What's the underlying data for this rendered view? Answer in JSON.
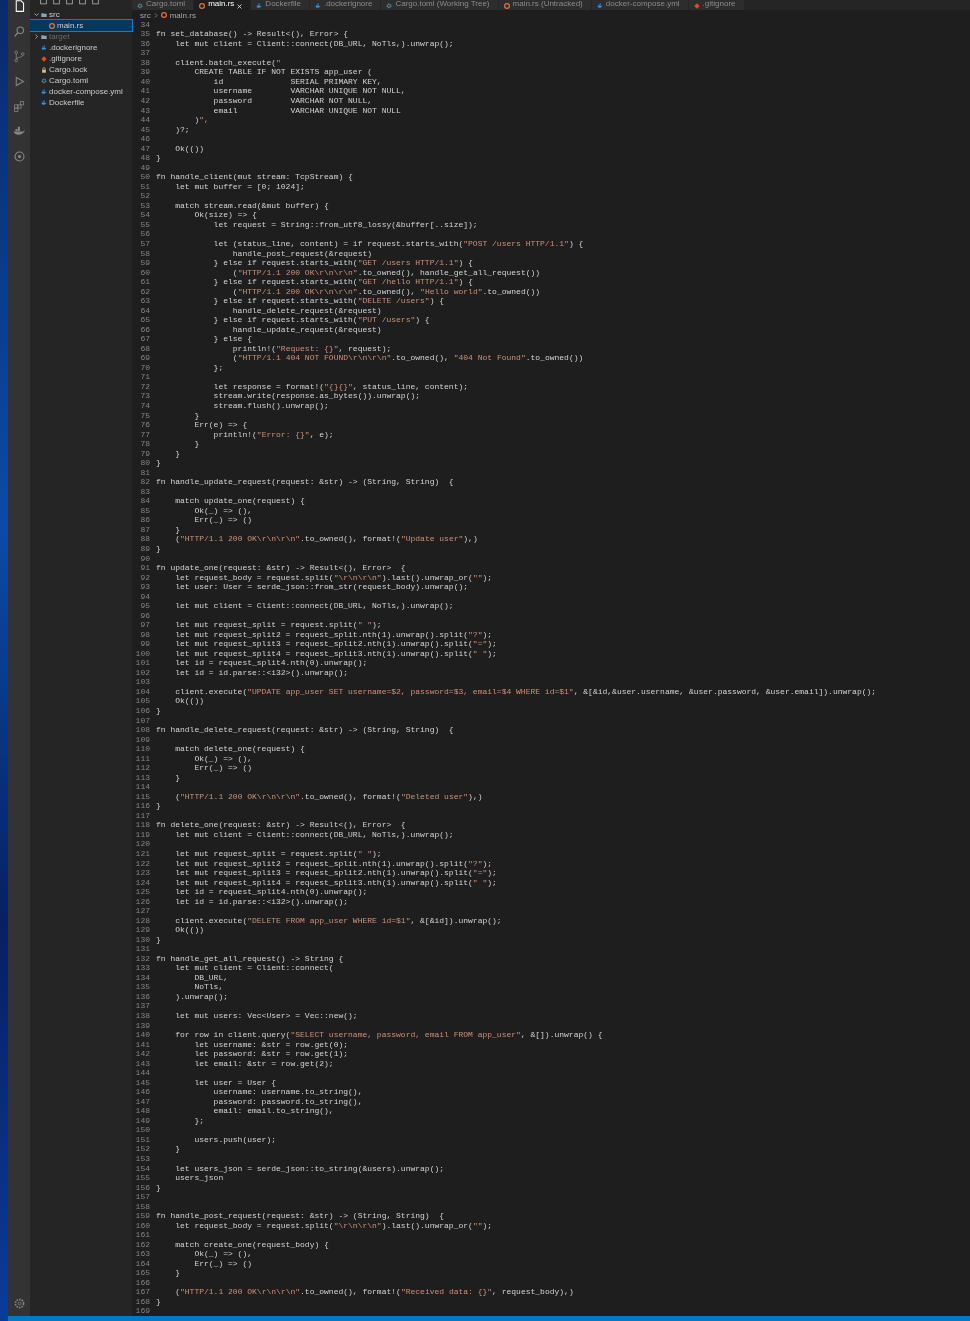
{
  "tabs": [
    {
      "label": "Cargo.toml",
      "kind": "gear",
      "selected": false
    },
    {
      "label": "main.rs",
      "kind": "rust",
      "selected": true
    },
    {
      "label": "Dockerfile",
      "kind": "docker",
      "selected": false
    },
    {
      "label": ".dockerignore",
      "kind": "docker",
      "selected": false
    },
    {
      "label": "Cargo.toml (Working Tree)",
      "kind": "gear",
      "selected": false
    },
    {
      "label": "main.rs (Untracked)",
      "kind": "rust",
      "selected": false
    },
    {
      "label": "docker-compose.yml",
      "kind": "docker",
      "selected": false
    },
    {
      "label": ".gitignore",
      "kind": "git",
      "selected": false
    }
  ],
  "explorer": {
    "items": [
      {
        "label": "src",
        "kind": "folder",
        "selected": false,
        "ignored": false,
        "expanded": true,
        "children": [
          {
            "label": "main.rs",
            "kind": "rust",
            "selected": true,
            "ignored": false
          }
        ]
      },
      {
        "label": "target",
        "kind": "folder",
        "selected": false,
        "ignored": true,
        "expanded": false
      },
      {
        "label": ".dockerignore",
        "kind": "docker",
        "selected": false,
        "ignored": false
      },
      {
        "label": ".gitignore",
        "kind": "git",
        "selected": false,
        "ignored": false
      },
      {
        "label": "Cargo.lock",
        "kind": "lock",
        "selected": false,
        "ignored": false
      },
      {
        "label": "Cargo.toml",
        "kind": "gear",
        "selected": false,
        "ignored": false
      },
      {
        "label": "docker-compose.yml",
        "kind": "docker",
        "selected": false,
        "ignored": false
      },
      {
        "label": "Dockerfile",
        "kind": "docker",
        "selected": false,
        "ignored": false
      }
    ]
  },
  "breadcrumb": [
    "src",
    "main.rs"
  ],
  "lines": [
    {
      "n": "34"
    },
    {
      "n": "35",
      "code": "fn set_database() -> Result<(), Error> {"
    },
    {
      "n": "36",
      "code": "    let mut client = Client::connect(DB_URL, NoTls,).unwrap();"
    },
    {
      "n": "37"
    },
    {
      "n": "38",
      "code": "    client.batch_execute(\""
    },
    {
      "n": "39",
      "code": "        CREATE TABLE IF NOT EXISTS app_user ("
    },
    {
      "n": "40",
      "code": "            id              SERIAL PRIMARY KEY,"
    },
    {
      "n": "41",
      "code": "            username        VARCHAR UNIQUE NOT NULL,"
    },
    {
      "n": "42",
      "code": "            password        VARCHAR NOT NULL,"
    },
    {
      "n": "43",
      "code": "            email           VARCHAR UNIQUE NOT NULL"
    },
    {
      "n": "44",
      "code": "        )\","
    },
    {
      "n": "45",
      "code": "    )?;"
    },
    {
      "n": "46"
    },
    {
      "n": "47",
      "code": "    Ok(())"
    },
    {
      "n": "48",
      "code": "}"
    },
    {
      "n": "49"
    },
    {
      "n": "50",
      "code": "fn handle_client(mut stream: TcpStream) {"
    },
    {
      "n": "51",
      "code": "    let mut buffer = [0; 1024];"
    },
    {
      "n": "52"
    },
    {
      "n": "53",
      "code": "    match stream.read(&mut buffer) {"
    },
    {
      "n": "54",
      "code": "        Ok(size) => {"
    },
    {
      "n": "55",
      "code": "            let request = String::from_utf8_lossy(&buffer[..size]);"
    },
    {
      "n": "56"
    },
    {
      "n": "57",
      "code": "            let (status_line, content) = if request.starts_with(\"POST /users HTTP/1.1\") {"
    },
    {
      "n": "58",
      "code": "                handle_post_request(&request)"
    },
    {
      "n": "59",
      "code": "            } else if request.starts_with(\"GET /users HTTP/1.1\") {"
    },
    {
      "n": "60",
      "code": "                (\"HTTP/1.1 200 OK\\r\\n\\r\\n\".to_owned(), handle_get_all_request())"
    },
    {
      "n": "61",
      "code": "            } else if request.starts_with(\"GET /hello HTTP/1.1\") {"
    },
    {
      "n": "62",
      "code": "                (\"HTTP/1.1 200 OK\\r\\n\\r\\n\".to_owned(), \"Hello world\".to_owned())"
    },
    {
      "n": "63",
      "code": "            } else if request.starts_with(\"DELETE /users\") {"
    },
    {
      "n": "64",
      "code": "                handle_delete_request(&request)"
    },
    {
      "n": "65",
      "code": "            } else if request.starts_with(\"PUT /users\") {"
    },
    {
      "n": "66",
      "code": "                handle_update_request(&request)"
    },
    {
      "n": "67",
      "code": "            } else {"
    },
    {
      "n": "68",
      "code": "                println!(\"Request: {}\", request);"
    },
    {
      "n": "69",
      "code": "                (\"HTTP/1.1 404 NOT FOUND\\r\\n\\r\\n\".to_owned(), \"404 Not Found\".to_owned())"
    },
    {
      "n": "70",
      "code": "            };"
    },
    {
      "n": "71"
    },
    {
      "n": "72",
      "code": "            let response = format!(\"{}{}\", status_line, content);"
    },
    {
      "n": "73",
      "code": "            stream.write(response.as_bytes()).unwrap();"
    },
    {
      "n": "74",
      "code": "            stream.flush().unwrap();"
    },
    {
      "n": "75",
      "code": "        }"
    },
    {
      "n": "76",
      "code": "        Err(e) => {"
    },
    {
      "n": "77",
      "code": "            println!(\"Error: {}\", e);"
    },
    {
      "n": "78",
      "code": "        }"
    },
    {
      "n": "79",
      "code": "    }"
    },
    {
      "n": "80",
      "code": "}"
    },
    {
      "n": "81"
    },
    {
      "n": "82",
      "code": "fn handle_update_request(request: &str) -> (String, String)  {"
    },
    {
      "n": "83"
    },
    {
      "n": "84",
      "code": "    match update_one(request) {"
    },
    {
      "n": "85",
      "code": "        Ok(_) => (),"
    },
    {
      "n": "86",
      "code": "        Err(_) => ()"
    },
    {
      "n": "87",
      "code": "    }"
    },
    {
      "n": "88",
      "code": "    (\"HTTP/1.1 200 OK\\r\\n\\r\\n\".to_owned(), format!(\"Update user\"),)"
    },
    {
      "n": "89",
      "code": "}"
    },
    {
      "n": "90"
    },
    {
      "n": "91",
      "code": "fn update_one(request: &str) -> Result<(), Error>  {"
    },
    {
      "n": "92",
      "code": "    let request_body = request.split(\"\\r\\n\\r\\n\").last().unwrap_or(\"\");"
    },
    {
      "n": "93",
      "code": "    let user: User = serde_json::from_str(request_body).unwrap();"
    },
    {
      "n": "94"
    },
    {
      "n": "95",
      "code": "    let mut client = Client::connect(DB_URL, NoTls,).unwrap();"
    },
    {
      "n": "96"
    },
    {
      "n": "97",
      "code": "    let mut request_split = request.split(\" \");"
    },
    {
      "n": "98",
      "code": "    let mut request_split2 = request_split.nth(1).unwrap().split(\"?\");"
    },
    {
      "n": "99",
      "code": "    let mut request_split3 = request_split2.nth(1).unwrap().split(\"=\");"
    },
    {
      "n": "100",
      "code": "    let mut request_split4 = request_split3.nth(1).unwrap().split(\" \");"
    },
    {
      "n": "101",
      "code": "    let id = request_split4.nth(0).unwrap();"
    },
    {
      "n": "102",
      "code": "    let id = id.parse::<i32>().unwrap();"
    },
    {
      "n": "103"
    },
    {
      "n": "104",
      "code": "    client.execute(\"UPDATE app_user SET username=$2, password=$3, email=$4 WHERE id=$1\", &[&id,&user.username, &user.password, &user.email]).unwrap();"
    },
    {
      "n": "105",
      "code": "    Ok(())"
    },
    {
      "n": "106",
      "code": "}"
    },
    {
      "n": "107"
    },
    {
      "n": "108",
      "code": "fn handle_delete_request(request: &str) -> (String, String)  {"
    },
    {
      "n": "109"
    },
    {
      "n": "110",
      "code": "    match delete_one(request) {"
    },
    {
      "n": "111",
      "code": "        Ok(_) => (),"
    },
    {
      "n": "112",
      "code": "        Err(_) => ()"
    },
    {
      "n": "113",
      "code": "    }"
    },
    {
      "n": "114"
    },
    {
      "n": "115",
      "code": "    (\"HTTP/1.1 200 OK\\r\\n\\r\\n\".to_owned(), format!(\"Deleted user\"),)"
    },
    {
      "n": "116",
      "code": "}"
    },
    {
      "n": "117"
    },
    {
      "n": "118",
      "code": "fn delete_one(request: &str) -> Result<(), Error>  {"
    },
    {
      "n": "119",
      "code": "    let mut client = Client::connect(DB_URL, NoTls,).unwrap();"
    },
    {
      "n": "120"
    },
    {
      "n": "121",
      "code": "    let mut request_split = request.split(\" \");"
    },
    {
      "n": "122",
      "code": "    let mut request_split2 = request_split.nth(1).unwrap().split(\"?\");"
    },
    {
      "n": "123",
      "code": "    let mut request_split3 = request_split2.nth(1).unwrap().split(\"=\");"
    },
    {
      "n": "124",
      "code": "    let mut request_split4 = request_split3.nth(1).unwrap().split(\" \");"
    },
    {
      "n": "125",
      "code": "    let id = request_split4.nth(0).unwrap();"
    },
    {
      "n": "126",
      "code": "    let id = id.parse::<i32>().unwrap();"
    },
    {
      "n": "127"
    },
    {
      "n": "128",
      "code": "    client.execute(\"DELETE FROM app_user WHERE id=$1\", &[&id]).unwrap();"
    },
    {
      "n": "129",
      "code": "    Ok(())"
    },
    {
      "n": "130",
      "code": "}"
    },
    {
      "n": "131"
    },
    {
      "n": "132",
      "code": "fn handle_get_all_request() -> String {"
    },
    {
      "n": "133",
      "code": "    let mut client = Client::connect("
    },
    {
      "n": "134",
      "code": "        DB_URL,"
    },
    {
      "n": "135",
      "code": "        NoTls,"
    },
    {
      "n": "136",
      "code": "    ).unwrap();"
    },
    {
      "n": "137"
    },
    {
      "n": "138",
      "code": "    let mut users: Vec<User> = Vec::new();"
    },
    {
      "n": "139"
    },
    {
      "n": "140",
      "code": "    for row in client.query(\"SELECT username, password, email FROM app_user\", &[]).unwrap() {"
    },
    {
      "n": "141",
      "code": "        let username: &str = row.get(0);"
    },
    {
      "n": "142",
      "code": "        let password: &str = row.get(1);"
    },
    {
      "n": "143",
      "code": "        let email: &str = row.get(2);"
    },
    {
      "n": "144"
    },
    {
      "n": "145",
      "code": "        let user = User {"
    },
    {
      "n": "146",
      "code": "            username: username.to_string(),"
    },
    {
      "n": "147",
      "code": "            password: password.to_string(),"
    },
    {
      "n": "148",
      "code": "            email: email.to_string(),"
    },
    {
      "n": "149",
      "code": "        };"
    },
    {
      "n": "150"
    },
    {
      "n": "151",
      "code": "        users.push(user);"
    },
    {
      "n": "152",
      "code": "    }"
    },
    {
      "n": "153"
    },
    {
      "n": "154",
      "code": "    let users_json = serde_json::to_string(&users).unwrap();"
    },
    {
      "n": "155",
      "code": "    users_json"
    },
    {
      "n": "156",
      "code": "}"
    },
    {
      "n": "157"
    },
    {
      "n": "158"
    },
    {
      "n": "159",
      "code": "fn handle_post_request(request: &str) -> (String, String)  {"
    },
    {
      "n": "160",
      "code": "    let request_body = request.split(\"\\r\\n\\r\\n\").last().unwrap_or(\"\");"
    },
    {
      "n": "161"
    },
    {
      "n": "162",
      "code": "    match create_one(request_body) {"
    },
    {
      "n": "163",
      "code": "        Ok(_) => (),"
    },
    {
      "n": "164",
      "code": "        Err(_) => ()"
    },
    {
      "n": "165",
      "code": "    }"
    },
    {
      "n": "166"
    },
    {
      "n": "167",
      "code": "    (\"HTTP/1.1 200 OK\\r\\n\\r\\n\".to_owned(), format!(\"Received data: {}\", request_body),)"
    },
    {
      "n": "168",
      "code": "}"
    },
    {
      "n": "169"
    }
  ]
}
